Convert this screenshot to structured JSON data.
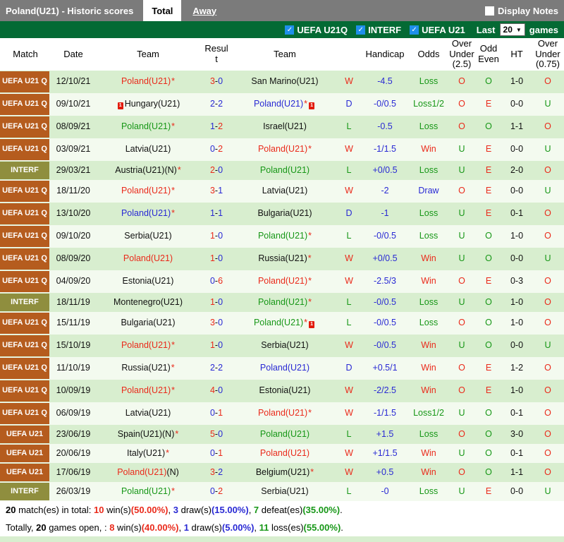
{
  "colors": {
    "red": "#ea2a1b",
    "blue": "#2929d4",
    "green": "#179717",
    "badge_orange": "#b55c1e",
    "badge_olive": "#8f8e3e",
    "bar_gray": "#7b7b7b",
    "bar_green": "#046a34",
    "row_green": "#d8eecf",
    "row_white": "#f3faef",
    "check_blue": "#1e8fea"
  },
  "topbar": {
    "title": "Poland(U21) - Historic scores",
    "tabs": [
      {
        "label": "Total",
        "active": true
      },
      {
        "label": "Away",
        "active": false
      }
    ],
    "display_notes_label": "Display Notes"
  },
  "filterbar": {
    "checkboxes": [
      {
        "label": "UEFA U21Q",
        "checked": true
      },
      {
        "label": "INTERF",
        "checked": true
      },
      {
        "label": "UEFA U21",
        "checked": true
      }
    ],
    "last_label": "Last",
    "games_count": "20",
    "games_label": "games"
  },
  "table": {
    "headers": [
      "Match",
      "Date",
      "Team",
      "Result",
      "Team",
      "",
      "Handicap",
      "Odds",
      "Over Under (2.5)",
      "Odd Even",
      "HT",
      "Over Under (0.75)"
    ],
    "rows": [
      {
        "comp": "UEFA U21 Q",
        "type": "q",
        "date": "12/10/21",
        "home": {
          "name": "Poland(U21)",
          "color": "red",
          "star": true
        },
        "score": {
          "h": 3,
          "a": 0
        },
        "away": {
          "name": "San Marino(U21)",
          "color": "black"
        },
        "result": "W",
        "handicap": "-4.5",
        "odds": "Loss",
        "ou25": "O",
        "oe": "O",
        "ht": "1-0",
        "ou075": "O"
      },
      {
        "comp": "UEFA U21 Q",
        "type": "q",
        "date": "09/10/21",
        "home": {
          "name": "Hungary(U21)",
          "color": "black",
          "card": "before"
        },
        "score": {
          "h": 2,
          "a": 2
        },
        "away": {
          "name": "Poland(U21)",
          "color": "blue",
          "star": true,
          "card": "after"
        },
        "result": "D",
        "handicap": "-0/0.5",
        "odds": "Loss1/2",
        "ou25": "O",
        "oe": "E",
        "ht": "0-0",
        "ou075": "U"
      },
      {
        "comp": "UEFA U21 Q",
        "type": "q",
        "date": "08/09/21",
        "home": {
          "name": "Poland(U21)",
          "color": "green",
          "star": true
        },
        "score": {
          "h": 1,
          "a": 2
        },
        "away": {
          "name": "Israel(U21)",
          "color": "black"
        },
        "result": "L",
        "handicap": "-0.5",
        "odds": "Loss",
        "ou25": "O",
        "oe": "O",
        "ht": "1-1",
        "ou075": "O"
      },
      {
        "comp": "UEFA U21 Q",
        "type": "q",
        "date": "03/09/21",
        "home": {
          "name": "Latvia(U21)",
          "color": "black"
        },
        "score": {
          "h": 0,
          "a": 2
        },
        "away": {
          "name": "Poland(U21)",
          "color": "red",
          "star": true
        },
        "result": "W",
        "handicap": "-1/1.5",
        "odds": "Win",
        "ou25": "U",
        "oe": "E",
        "ht": "0-0",
        "ou075": "U"
      },
      {
        "comp": "INTERF",
        "type": "interf",
        "date": "29/03/21",
        "home": {
          "name": "Austria(U21)",
          "color": "black",
          "n": true,
          "star": true
        },
        "score": {
          "h": 2,
          "a": 0
        },
        "away": {
          "name": "Poland(U21)",
          "color": "green"
        },
        "result": "L",
        "handicap": "+0/0.5",
        "odds": "Loss",
        "ou25": "U",
        "oe": "E",
        "ht": "2-0",
        "ou075": "O"
      },
      {
        "comp": "UEFA U21 Q",
        "type": "q",
        "date": "18/11/20",
        "home": {
          "name": "Poland(U21)",
          "color": "red",
          "star": true
        },
        "score": {
          "h": 3,
          "a": 1
        },
        "away": {
          "name": "Latvia(U21)",
          "color": "black"
        },
        "result": "W",
        "handicap": "-2",
        "odds": "Draw",
        "ou25": "O",
        "oe": "E",
        "ht": "0-0",
        "ou075": "U"
      },
      {
        "comp": "UEFA U21 Q",
        "type": "q",
        "date": "13/10/20",
        "home": {
          "name": "Poland(U21)",
          "color": "blue",
          "star": true
        },
        "score": {
          "h": 1,
          "a": 1
        },
        "away": {
          "name": "Bulgaria(U21)",
          "color": "black"
        },
        "result": "D",
        "handicap": "-1",
        "odds": "Loss",
        "ou25": "U",
        "oe": "E",
        "ht": "0-1",
        "ou075": "O"
      },
      {
        "comp": "UEFA U21 Q",
        "type": "q",
        "date": "09/10/20",
        "home": {
          "name": "Serbia(U21)",
          "color": "black"
        },
        "score": {
          "h": 1,
          "a": 0
        },
        "away": {
          "name": "Poland(U21)",
          "color": "green",
          "star": true
        },
        "result": "L",
        "handicap": "-0/0.5",
        "odds": "Loss",
        "ou25": "U",
        "oe": "O",
        "ht": "1-0",
        "ou075": "O"
      },
      {
        "comp": "UEFA U21 Q",
        "type": "q",
        "date": "08/09/20",
        "home": {
          "name": "Poland(U21)",
          "color": "red"
        },
        "score": {
          "h": 1,
          "a": 0
        },
        "away": {
          "name": "Russia(U21)",
          "color": "black",
          "star": true
        },
        "result": "W",
        "handicap": "+0/0.5",
        "odds": "Win",
        "ou25": "U",
        "oe": "O",
        "ht": "0-0",
        "ou075": "U"
      },
      {
        "comp": "UEFA U21 Q",
        "type": "q",
        "date": "04/09/20",
        "home": {
          "name": "Estonia(U21)",
          "color": "black"
        },
        "score": {
          "h": 0,
          "a": 6
        },
        "away": {
          "name": "Poland(U21)",
          "color": "red",
          "star": true
        },
        "result": "W",
        "handicap": "-2.5/3",
        "odds": "Win",
        "ou25": "O",
        "oe": "E",
        "ht": "0-3",
        "ou075": "O"
      },
      {
        "comp": "INTERF",
        "type": "interf",
        "date": "18/11/19",
        "home": {
          "name": "Montenegro(U21)",
          "color": "black"
        },
        "score": {
          "h": 1,
          "a": 0
        },
        "away": {
          "name": "Poland(U21)",
          "color": "green",
          "star": true
        },
        "result": "L",
        "handicap": "-0/0.5",
        "odds": "Loss",
        "ou25": "U",
        "oe": "O",
        "ht": "1-0",
        "ou075": "O"
      },
      {
        "comp": "UEFA U21 Q",
        "type": "q",
        "date": "15/11/19",
        "home": {
          "name": "Bulgaria(U21)",
          "color": "black"
        },
        "score": {
          "h": 3,
          "a": 0
        },
        "away": {
          "name": "Poland(U21)",
          "color": "green",
          "star": true,
          "card": "after"
        },
        "result": "L",
        "handicap": "-0/0.5",
        "odds": "Loss",
        "ou25": "O",
        "oe": "O",
        "ht": "1-0",
        "ou075": "O"
      },
      {
        "comp": "UEFA U21 Q",
        "type": "q",
        "date": "15/10/19",
        "home": {
          "name": "Poland(U21)",
          "color": "red",
          "star": true
        },
        "score": {
          "h": 1,
          "a": 0
        },
        "away": {
          "name": "Serbia(U21)",
          "color": "black"
        },
        "result": "W",
        "handicap": "-0/0.5",
        "odds": "Win",
        "ou25": "U",
        "oe": "O",
        "ht": "0-0",
        "ou075": "U"
      },
      {
        "comp": "UEFA U21 Q",
        "type": "q",
        "date": "11/10/19",
        "home": {
          "name": "Russia(U21)",
          "color": "black",
          "star": true
        },
        "score": {
          "h": 2,
          "a": 2
        },
        "away": {
          "name": "Poland(U21)",
          "color": "blue"
        },
        "result": "D",
        "handicap": "+0.5/1",
        "odds": "Win",
        "ou25": "O",
        "oe": "E",
        "ht": "1-2",
        "ou075": "O"
      },
      {
        "comp": "UEFA U21 Q",
        "type": "q",
        "date": "10/09/19",
        "home": {
          "name": "Poland(U21)",
          "color": "red",
          "star": true
        },
        "score": {
          "h": 4,
          "a": 0
        },
        "away": {
          "name": "Estonia(U21)",
          "color": "black"
        },
        "result": "W",
        "handicap": "-2/2.5",
        "odds": "Win",
        "ou25": "O",
        "oe": "E",
        "ht": "1-0",
        "ou075": "O"
      },
      {
        "comp": "UEFA U21 Q",
        "type": "q",
        "date": "06/09/19",
        "home": {
          "name": "Latvia(U21)",
          "color": "black"
        },
        "score": {
          "h": 0,
          "a": 1
        },
        "away": {
          "name": "Poland(U21)",
          "color": "red",
          "star": true
        },
        "result": "W",
        "handicap": "-1/1.5",
        "odds": "Loss1/2",
        "ou25": "U",
        "oe": "O",
        "ht": "0-1",
        "ou075": "O"
      },
      {
        "comp": "UEFA U21",
        "type": "u21",
        "date": "23/06/19",
        "home": {
          "name": "Spain(U21)",
          "color": "black",
          "n": true,
          "star": true
        },
        "score": {
          "h": 5,
          "a": 0
        },
        "away": {
          "name": "Poland(U21)",
          "color": "green"
        },
        "result": "L",
        "handicap": "+1.5",
        "odds": "Loss",
        "ou25": "O",
        "oe": "O",
        "ht": "3-0",
        "ou075": "O"
      },
      {
        "comp": "UEFA U21",
        "type": "u21",
        "date": "20/06/19",
        "home": {
          "name": "Italy(U21)",
          "color": "black",
          "star": true
        },
        "score": {
          "h": 0,
          "a": 1
        },
        "away": {
          "name": "Poland(U21)",
          "color": "red"
        },
        "result": "W",
        "handicap": "+1/1.5",
        "odds": "Win",
        "ou25": "U",
        "oe": "O",
        "ht": "0-1",
        "ou075": "O"
      },
      {
        "comp": "UEFA U21",
        "type": "u21",
        "date": "17/06/19",
        "home": {
          "name": "Poland(U21)",
          "color": "red",
          "n": true
        },
        "score": {
          "h": 3,
          "a": 2
        },
        "away": {
          "name": "Belgium(U21)",
          "color": "black",
          "star": true
        },
        "result": "W",
        "handicap": "+0.5",
        "odds": "Win",
        "ou25": "O",
        "oe": "O",
        "ht": "1-1",
        "ou075": "O"
      },
      {
        "comp": "INTERF",
        "type": "interf",
        "date": "26/03/19",
        "home": {
          "name": "Poland(U21)",
          "color": "green",
          "star": true
        },
        "score": {
          "h": 0,
          "a": 2
        },
        "away": {
          "name": "Serbia(U21)",
          "color": "black"
        },
        "result": "L",
        "handicap": "-0",
        "odds": "Loss",
        "ou25": "U",
        "oe": "E",
        "ht": "0-0",
        "ou075": "U"
      }
    ]
  },
  "footer": {
    "line1": [
      {
        "t": "20",
        "b": 1
      },
      {
        "t": " match(es) in total: "
      },
      {
        "t": "10",
        "c": "red",
        "b": 1
      },
      {
        "t": " win(s)"
      },
      {
        "t": "(50.00%)",
        "c": "red",
        "b": 1
      },
      {
        "t": ", "
      },
      {
        "t": "3",
        "c": "blue",
        "b": 1
      },
      {
        "t": " draw(s)"
      },
      {
        "t": "(15.00%)",
        "c": "blue",
        "b": 1
      },
      {
        "t": ", "
      },
      {
        "t": "7",
        "c": "green",
        "b": 1
      },
      {
        "t": " defeat(es)"
      },
      {
        "t": "(35.00%)",
        "c": "green",
        "b": 1
      },
      {
        "t": "."
      }
    ],
    "line2": [
      {
        "t": "Totally, "
      },
      {
        "t": "20",
        "b": 1
      },
      {
        "t": " games open, : "
      },
      {
        "t": "8",
        "c": "red",
        "b": 1
      },
      {
        "t": " win(s)"
      },
      {
        "t": "(40.00%)",
        "c": "red",
        "b": 1
      },
      {
        "t": ", "
      },
      {
        "t": "1",
        "c": "blue",
        "b": 1
      },
      {
        "t": " draw(s)"
      },
      {
        "t": "(5.00%)",
        "c": "blue",
        "b": 1
      },
      {
        "t": ", "
      },
      {
        "t": "11",
        "c": "green",
        "b": 1
      },
      {
        "t": " loss(es)"
      },
      {
        "t": "(55.00%)",
        "c": "green",
        "b": 1
      },
      {
        "t": "."
      }
    ]
  }
}
